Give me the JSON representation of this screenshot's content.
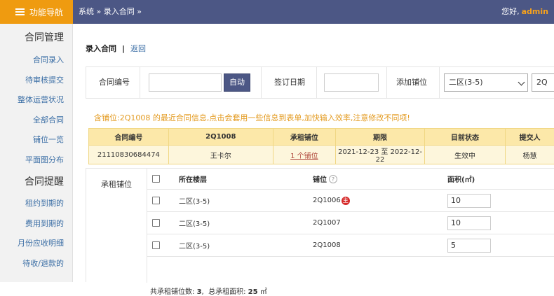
{
  "topbar": {
    "nav_label": "功能导航",
    "breadcrumb": "系统 » 录入合同 »",
    "greeting": "您好,",
    "username": "admin"
  },
  "sidebar": {
    "section1_title": "合同管理",
    "section1_items": [
      "合同录入",
      "待审核提交",
      "整体运营状况",
      "全部合同",
      "铺位一览",
      "平面图分布"
    ],
    "section2_title": "合同提醒",
    "section2_items": [
      "租约到期的",
      "费用到期的",
      "月份应收明细",
      "待收/退款的"
    ]
  },
  "page": {
    "title": "录入合同",
    "separator": "|",
    "back_label": "返回"
  },
  "form": {
    "contract_no_label": "合同编号",
    "contract_no_value": "",
    "auto_button": "自动",
    "sign_date_label": "签订日期",
    "sign_date_value": "",
    "add_shop_label": "添加铺位",
    "zone_select_value": "二区(3-5)",
    "shop_select_value": "2Q"
  },
  "notice": "含铺位:2Q1008 的最近合同信息,点击会套用一些信息到表单,加快输入效率,注意修改不同项!",
  "recent_contract": {
    "headers": [
      "合同编号",
      "2Q1008",
      "承租铺位",
      "期限",
      "目前状态",
      "提交人"
    ],
    "row": {
      "contract_no": "21110830684474",
      "tenant": "王卡尔",
      "shops_link": "1 个铺位",
      "term": "2021-12-23 至 2022-12-22",
      "status": "生效中",
      "submitter": "杨慧"
    }
  },
  "lease_shops": {
    "label": "承租铺位",
    "headers": {
      "floor": "所在楼层",
      "shop": "铺位",
      "area": "面积(㎡)"
    },
    "help_glyph": "?",
    "rows": [
      {
        "floor": "二区(3-5)",
        "shop": "2Q1006",
        "main_badge": "主",
        "area": "10"
      },
      {
        "floor": "二区(3-5)",
        "shop": "2Q1007",
        "main_badge": "",
        "area": "10"
      },
      {
        "floor": "二区(3-5)",
        "shop": "2Q1008",
        "main_badge": "",
        "area": "5"
      }
    ],
    "summary": {
      "count_label": "共承租铺位数:",
      "count": "3",
      "count_suffix": ",",
      "area_label": "总承租面积:",
      "area": "25",
      "area_unit": "㎡"
    }
  },
  "colors": {
    "topbar": "#4c5785",
    "nav_orange": "#ef9b10",
    "link_blue": "#3b6ea5",
    "notice_orange": "#e39a1f",
    "table_header_bg": "#fce8a9",
    "table_row_bg": "#fdf6dc",
    "badge_red": "#d62b2b"
  },
  "icons": {
    "nav": "hamburger-icon",
    "select_caret": "chevron-down-icon",
    "help": "question-circle-icon",
    "main_badge": "main-shop-badge"
  }
}
